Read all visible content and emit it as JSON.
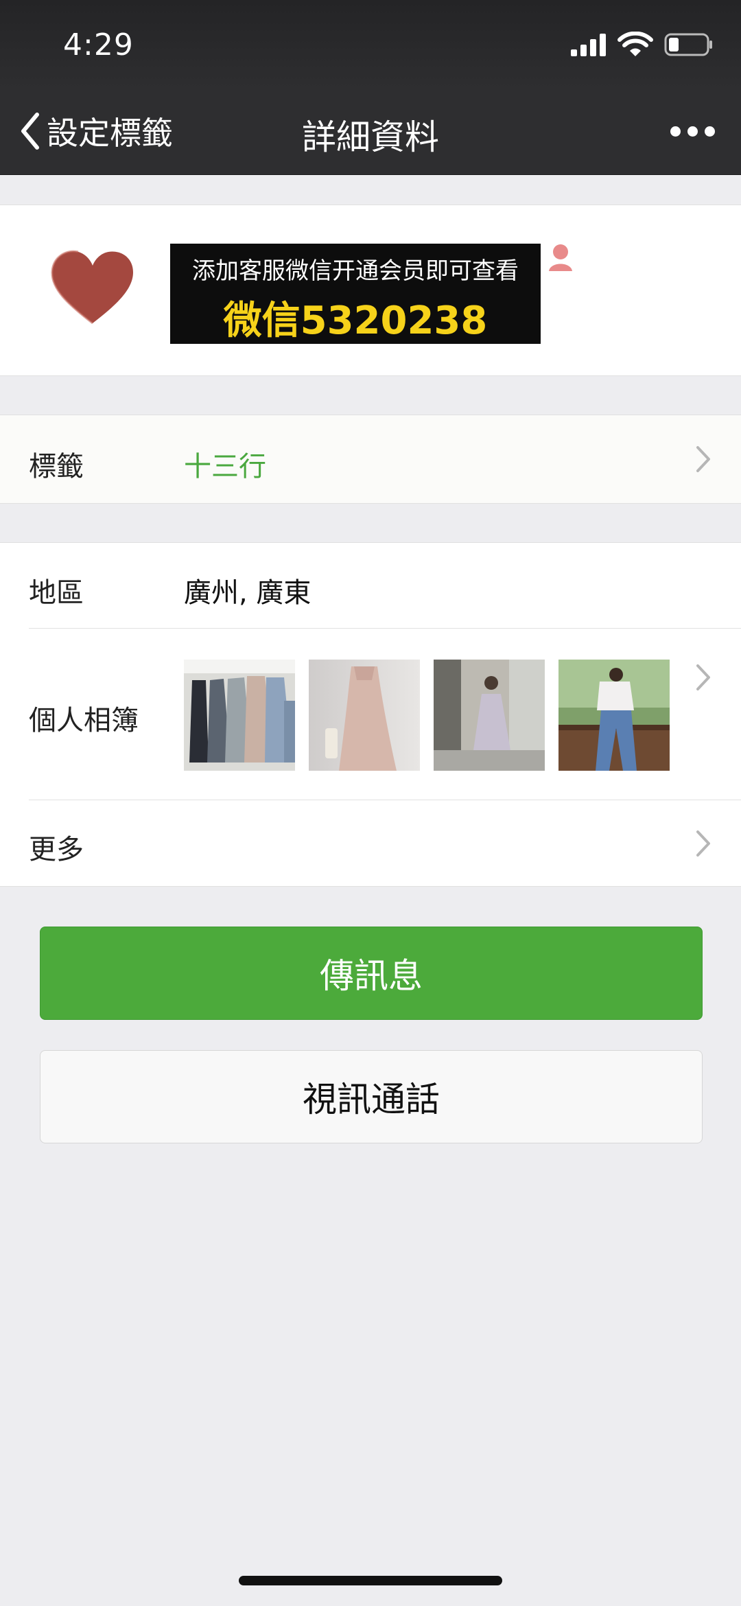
{
  "status_bar": {
    "time": "4:29"
  },
  "nav": {
    "back_label": "設定標籤",
    "title": "詳細資料"
  },
  "profile": {
    "promo_line1": "添加客服微信开通会员即可查看",
    "promo_line2": "微信5320238"
  },
  "tag_row": {
    "label": "標籤",
    "value": "十三行"
  },
  "region_row": {
    "label": "地區",
    "value": "廣州, 廣東"
  },
  "album_row": {
    "label": "個人相簿"
  },
  "more_row": {
    "label": "更多"
  },
  "buttons": {
    "message": "傳訊息",
    "video_call": "視訊通話"
  },
  "colors": {
    "accent_green": "#4caa3b",
    "tag_green": "#4aa83f",
    "nav_bg": "#2e2e30",
    "promo_yellow": "#f6d21a"
  }
}
